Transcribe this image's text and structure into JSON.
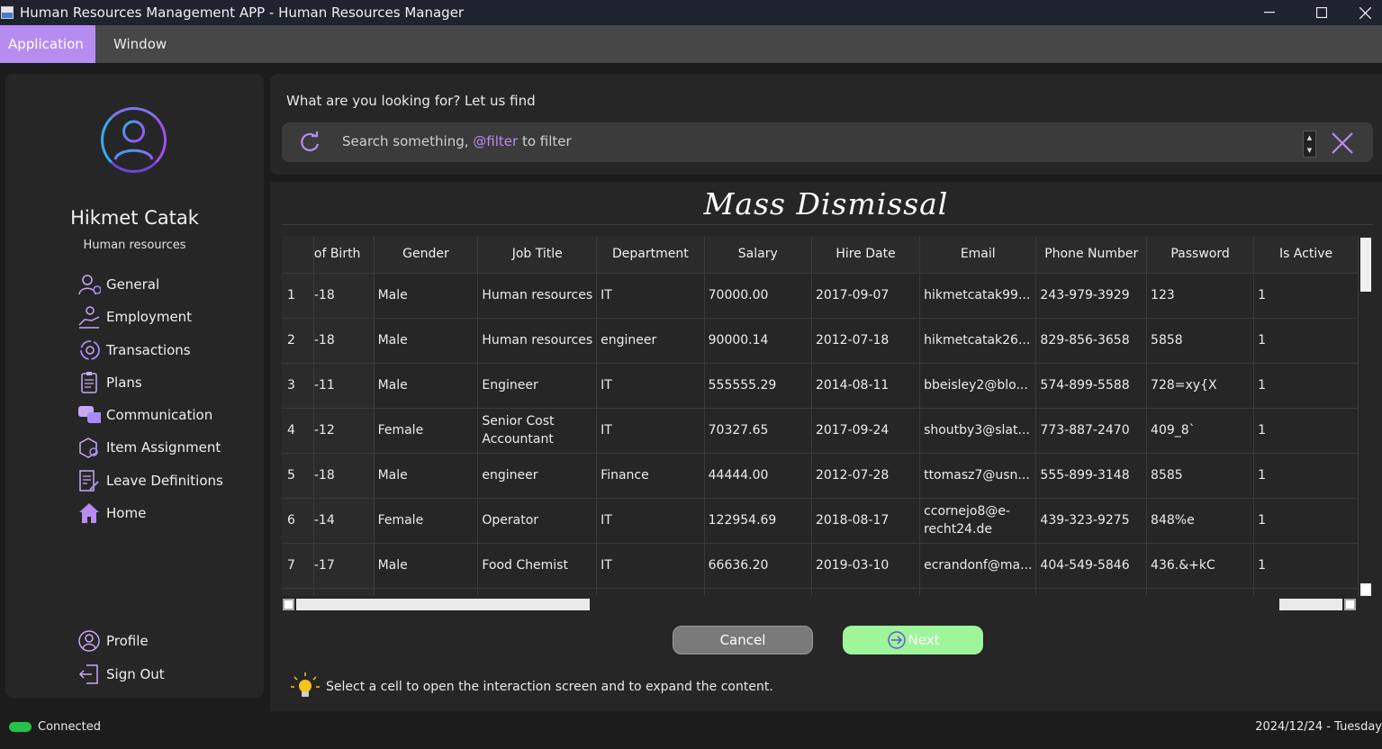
{
  "window": {
    "title": "Human Resources Management APP - Human Resources Manager",
    "minimize": "—",
    "maximize": "☐",
    "close": "✕"
  },
  "menu": {
    "items": [
      "Application",
      "Window"
    ]
  },
  "sidebar": {
    "user_name": "Hikmet Catak",
    "user_role": "Human resources",
    "nav": [
      {
        "label": "General",
        "icon": "users-gear-icon"
      },
      {
        "label": "Employment",
        "icon": "hand-user-icon"
      },
      {
        "label": "Transactions",
        "icon": "cycle-gear-icon"
      },
      {
        "label": "Plans",
        "icon": "clipboard-icon"
      },
      {
        "label": "Communication",
        "icon": "chat-bubbles-icon"
      },
      {
        "label": "Item Assignment",
        "icon": "box-gear-icon"
      },
      {
        "label": "Leave Definitions",
        "icon": "document-edit-icon"
      },
      {
        "label": "Home",
        "icon": "home-icon"
      }
    ],
    "bottom": [
      {
        "label": "Profile",
        "icon": "user-circle-icon"
      },
      {
        "label": "Sign Out",
        "icon": "sign-out-icon"
      }
    ]
  },
  "search": {
    "prompt": "What are you looking for? Let us find",
    "placeholder_prefix": "Search something, ",
    "placeholder_filter": "@filter",
    "placeholder_suffix": " to filter",
    "spinner_up": "▲",
    "spinner_down": "▼"
  },
  "page": {
    "title": "Mass Dismissal"
  },
  "table": {
    "columns": [
      "of Birth",
      "Gender",
      "Job Title",
      "Department",
      "Salary",
      "Hire Date",
      "Email",
      "Phone Number",
      "Password",
      "Is Active"
    ],
    "rows": [
      {
        "n": "1",
        "dob": "-18",
        "gender": "Male",
        "job": "Human resources",
        "dept": "IT",
        "salary": "70000.00",
        "hire": "2017-09-07",
        "email": "hikmetcatak99...",
        "phone": "243-979-3929",
        "password": "123",
        "active": "1"
      },
      {
        "n": "2",
        "dob": "-18",
        "gender": "Male",
        "job": "Human resources",
        "dept": "engineer",
        "salary": "90000.14",
        "hire": "2012-07-18",
        "email": "hikmetcatak26...",
        "phone": "829-856-3658",
        "password": "5858",
        "active": "1"
      },
      {
        "n": "3",
        "dob": "-11",
        "gender": "Male",
        "job": "Engineer",
        "dept": "IT",
        "salary": "555555.29",
        "hire": "2014-08-11",
        "email": "bbeisley2@blo...",
        "phone": "574-899-5588",
        "password": "728=xy{X",
        "active": "1"
      },
      {
        "n": "4",
        "dob": "-12",
        "gender": "Female",
        "job": "Senior Cost Accountant",
        "dept": "IT",
        "salary": "70327.65",
        "hire": "2017-09-24",
        "email": "shoutby3@slat...",
        "phone": "773-887-2470",
        "password": "409_8`",
        "active": "1"
      },
      {
        "n": "5",
        "dob": "-18",
        "gender": "Male",
        "job": "engineer",
        "dept": "Finance",
        "salary": "44444.00",
        "hire": "2012-07-28",
        "email": "ttomasz7@usn...",
        "phone": "555-899-3148",
        "password": "8585",
        "active": "1"
      },
      {
        "n": "6",
        "dob": "-14",
        "gender": "Female",
        "job": "Operator",
        "dept": "IT",
        "salary": "122954.69",
        "hire": "2018-08-17",
        "email": "ccornejo8@e-recht24.de",
        "phone": "439-323-9275",
        "password": "848%e",
        "active": "1"
      },
      {
        "n": "7",
        "dob": "-17",
        "gender": "Male",
        "job": "Food Chemist",
        "dept": "IT",
        "salary": "66636.20",
        "hire": "2019-03-10",
        "email": "ecrandonf@ma...",
        "phone": "404-549-5846",
        "password": "436.&+kC",
        "active": "1"
      }
    ]
  },
  "buttons": {
    "cancel": "Cancel",
    "next": "Next"
  },
  "hint": "Select a cell to open the interaction screen and to expand the content.",
  "status": {
    "connection": "Connected",
    "date": "2024/12/24 - Tuesday"
  },
  "colors": {
    "accent": "#b68cf0",
    "connected": "#21c34a",
    "next_button": "#9ef59a"
  }
}
